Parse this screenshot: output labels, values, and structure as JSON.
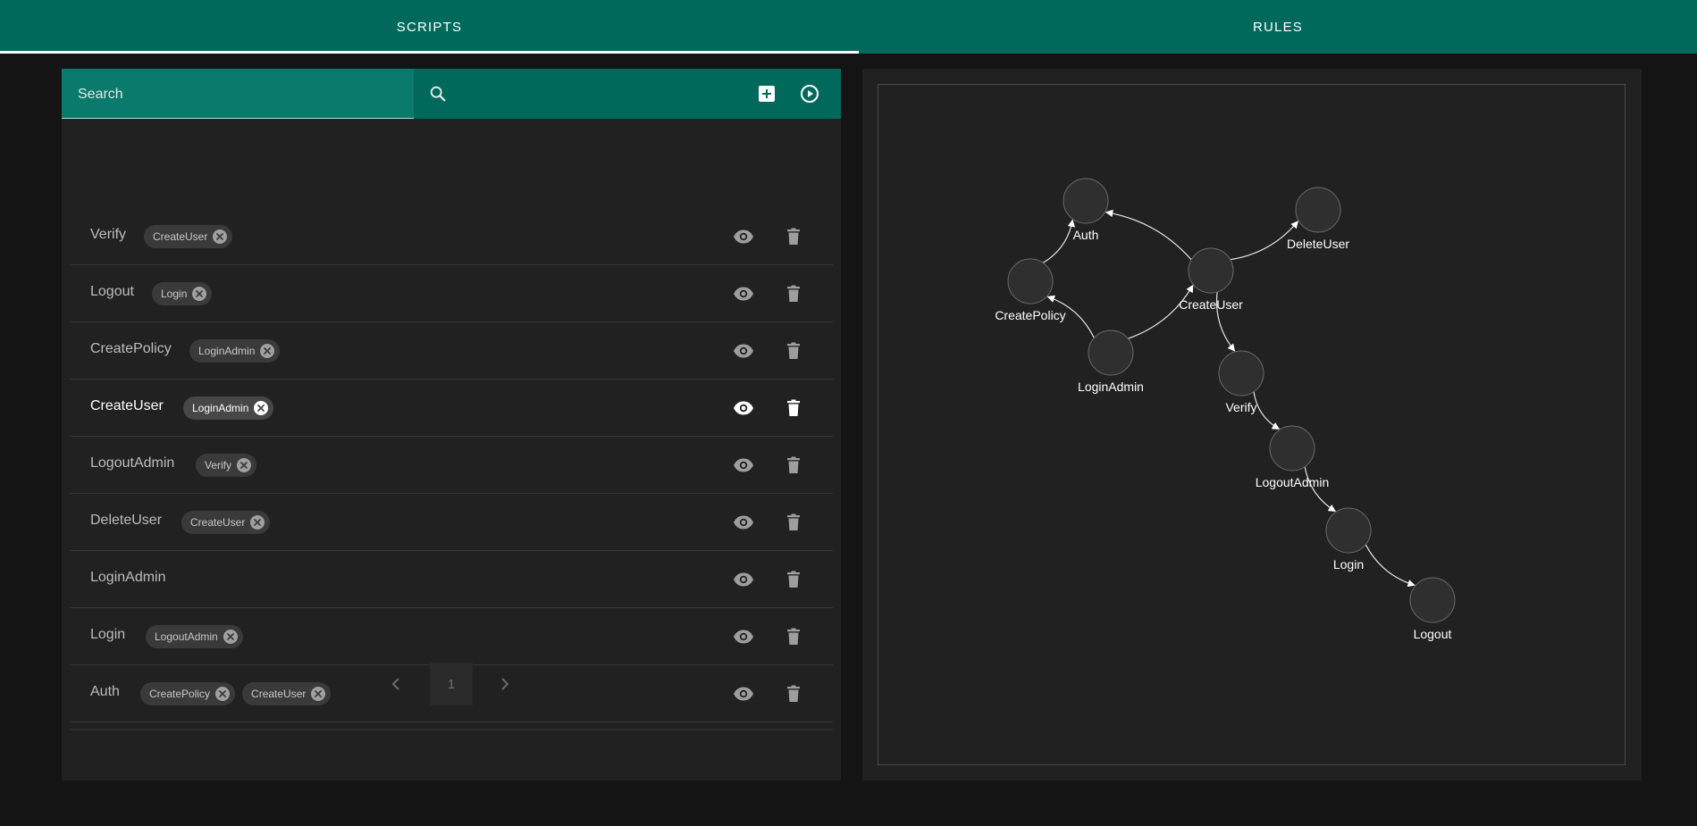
{
  "tabs": [
    {
      "label": "SCRIPTS"
    },
    {
      "label": "RULES"
    }
  ],
  "toolbar": {
    "search_placeholder": "Search",
    "search_value": "",
    "icons": [
      "search-icon",
      "add-box-icon",
      "play-circle-icon"
    ]
  },
  "scripts": [
    {
      "name": "Verify",
      "deps": [
        "CreateUser"
      ]
    },
    {
      "name": "Logout",
      "deps": [
        "Login"
      ]
    },
    {
      "name": "CreatePolicy",
      "deps": [
        "LoginAdmin"
      ]
    },
    {
      "name": "CreateUser",
      "deps": [
        "LoginAdmin"
      ],
      "active": true
    },
    {
      "name": "LogoutAdmin",
      "deps": [
        "Verify"
      ]
    },
    {
      "name": "DeleteUser",
      "deps": [
        "CreateUser"
      ]
    },
    {
      "name": "LoginAdmin",
      "deps": []
    },
    {
      "name": "Login",
      "deps": [
        "LogoutAdmin"
      ]
    },
    {
      "name": "Auth",
      "deps": [
        "CreatePolicy",
        "CreateUser"
      ]
    }
  ],
  "pagination": {
    "page": "1"
  },
  "graph": {
    "nodes": [
      {
        "id": "Auth",
        "label": "Auth"
      },
      {
        "id": "DeleteUser",
        "label": "DeleteUser"
      },
      {
        "id": "CreatePolicy",
        "label": "CreatePolicy"
      },
      {
        "id": "CreateUser",
        "label": "CreateUser"
      },
      {
        "id": "LoginAdmin",
        "label": "LoginAdmin"
      },
      {
        "id": "Verify",
        "label": "Verify"
      },
      {
        "id": "LogoutAdmin",
        "label": "LogoutAdmin"
      },
      {
        "id": "Login",
        "label": "Login"
      },
      {
        "id": "Logout",
        "label": "Logout"
      }
    ],
    "edges": [
      {
        "from": "CreatePolicy",
        "to": "Auth"
      },
      {
        "from": "CreateUser",
        "to": "Auth"
      },
      {
        "from": "LoginAdmin",
        "to": "CreatePolicy"
      },
      {
        "from": "LoginAdmin",
        "to": "CreateUser"
      },
      {
        "from": "CreateUser",
        "to": "DeleteUser"
      },
      {
        "from": "CreateUser",
        "to": "Verify"
      },
      {
        "from": "Verify",
        "to": "LogoutAdmin"
      },
      {
        "from": "LogoutAdmin",
        "to": "Login"
      },
      {
        "from": "Login",
        "to": "Logout"
      }
    ]
  },
  "colors": {
    "primary": "#00695c",
    "background": "#141414",
    "panel": "#212121",
    "node": "#2f2f2f"
  }
}
